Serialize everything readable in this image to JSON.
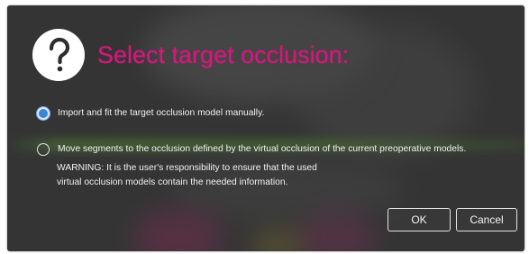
{
  "dialog": {
    "icon": "question-mark-icon",
    "title": "Select target occlusion:",
    "title_color": "#d11a7c",
    "options": [
      {
        "label": "Import and fit the target occlusion model manually.",
        "selected": true
      },
      {
        "label": "Move segments to the occlusion defined by the virtual occlusion of the current preoperative models.",
        "selected": false
      }
    ],
    "warning_lines": [
      "WARNING: It is the user's responsibility to ensure that the used",
      "virtual occlusion models contain the needed information."
    ],
    "buttons": {
      "ok": "OK",
      "cancel": "Cancel"
    },
    "radio_selected_color": "#3c84d8"
  }
}
